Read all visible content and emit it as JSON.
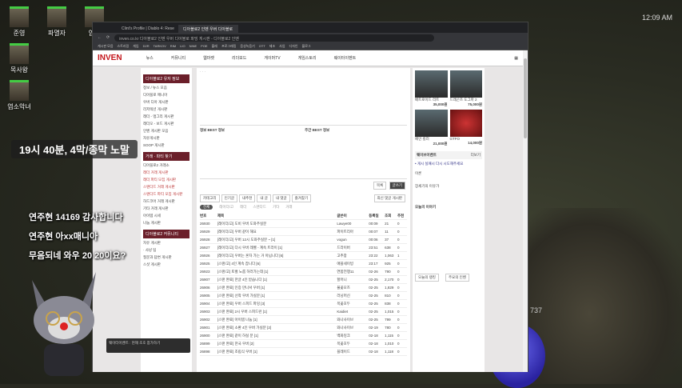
{
  "desktop": {
    "icons": [
      "준영",
      "파멸자",
      "염소",
      "목사왕",
      "염소악녀"
    ]
  },
  "system": {
    "clock": "12:09 AM"
  },
  "game": {
    "value": "737"
  },
  "overlay": {
    "caption": "19시 40분, 4막/종막 노말",
    "chat": [
      "연주현  14169 감사합니다",
      "연주현  아xx매니아",
      "무음되네  와우 20 20이요?"
    ]
  },
  "browser": {
    "tabs": [
      "Clint's Profile | Diablo 4: Rese",
      "디아블로2 인벤 우버 디아블로"
    ],
    "url": "inven.co.kr  디아블로2 인벤 우버 디아블로 파밍 게시판 - 디아블로2 인벤",
    "bookmarks": [
      "게시판 모음",
      "스트리밍",
      "게임",
      "D2R",
      "TARKOV",
      "RIM",
      "LIO",
      "NINE",
      "POE",
      "블레",
      "프로그래밍",
      "음성녹음기",
      "OTT",
      "제조",
      "사업",
      "디자인",
      "블로그"
    ]
  },
  "inven": {
    "logo": "INVEN",
    "nav": [
      "뉴스",
      "커뮤니티",
      "웹마켓",
      "리더보드",
      "게이머TV",
      "게임스토리",
      "웨이터이벤트"
    ],
    "left_nav": {
      "sections": [
        {
          "title": "디아블로2 유저 정보",
          "items": [
            "정보 / 뉴스 모음",
            "디아블로 매니아",
            "우버 디아 게시판",
            "리저렉션 게시판",
            "래더 - 앵그리 게시판",
            "래더오 - 보드 게시판",
            "인벤 게시판 모음",
            "자유게시판",
            "SOOP 게시판"
          ]
        },
        {
          "title": "거래 · 파티 찾기",
          "items": [
            "디아블로2 거래소",
            "래더 거래 게시판",
            "래더 파티 모집 게시판",
            "스탠다드 거래 게시판",
            "스탠다드 파티 모집 게시판",
            "하드코어 거래 게시판",
            "기타 거래 게시판",
            "아이템 시세",
            "나눔 게시판"
          ]
        },
        {
          "title": "디아블로2 커뮤니티",
          "items": [
            "자유 게시판",
            "· 사냥 팁",
            "질문과 답변 게시판",
            "스샷 게시판"
          ]
        }
      ]
    },
    "board": {
      "best_titles": [
        "정보 BEST 정보",
        "주간 BEST 정보"
      ],
      "buttons": [
        "카테고리",
        "인기글",
        "내추천",
        "내 글",
        "내 댓글",
        "즐겨찾기"
      ],
      "sort": "최신 댓글 게시판",
      "filter_tabs": [
        "전체",
        "레이더/고",
        "래더",
        "스탠다드",
        "기타",
        "거래"
      ],
      "headers": [
        "번호",
        "제목",
        "글쓴이",
        "등록일",
        "조회",
        "추천"
      ],
      "action_buttons": [
        "목록",
        "글쓰기"
      ],
      "rows": [
        [
          "26930",
          "[레이더/고] 도비 우버 도와주실분",
          "Lawye00",
          "00:09",
          "21",
          "0"
        ],
        [
          "26929",
          "[레이더/고] 우버 같이 해요",
          "파이트리아",
          "00:07",
          "11",
          "0"
        ],
        [
          "26928",
          "[레이더/고] 우버 12시 도와주실분 ~ [1]",
          "vogun",
          "00:06",
          "37",
          "0"
        ],
        [
          "26927",
          "[레이더/고] 다시 우버 레벨 - 계속 트라이 [1]",
          "드라이버",
          "23:51",
          "638",
          "0"
        ],
        [
          "26926",
          "[레이더/고] 우버는 혼자 가는 거 아닙니다 [6]",
          "고추참",
          "23:22",
          "1,063",
          "1"
        ],
        [
          "26925",
          "[스탠/고] 4인 계속 잡니다 [6]",
          "애플세이빙",
          "23:17",
          "925",
          "0"
        ],
        [
          "26923",
          "[스탠/고] 토벌 노룹 하러가는데 [1]",
          "연합전쟁11",
          "02-26",
          "790",
          "0"
        ],
        [
          "26907",
          "[스탠 완료] 한글 4인 받습니다 [1]",
          "할머니",
          "02-25",
          "2,170",
          "0"
        ],
        [
          "26906",
          "[스탠 완료] 인증 만나서 우버 [1]",
          "불꽃모즈",
          "02-25",
          "1,829",
          "0"
        ],
        [
          "26905",
          "[스탠 완료] 선착 우버 가실분 [1]",
          "러닝머신",
          "02-25",
          "810",
          "0"
        ],
        [
          "26904",
          "[스탠 완료] 우버 스피드 파밍 [3]",
          "목꽃호두",
          "02-25",
          "838",
          "0"
        ],
        [
          "26903",
          "[스탠 완료] 2시 우버 스피드런 [1]",
          "Kaidiet",
          "02-25",
          "1,015",
          "0"
        ],
        [
          "26902",
          "[스탠 완료] 아이템 나눔 [1]",
          "와나사이브",
          "02-25",
          "799",
          "0"
        ],
        [
          "26901",
          "[스탠 완료] 소환 4인 우버 가실분 [2]",
          "와나사이브",
          "02-19",
          "780",
          "0"
        ],
        [
          "26900",
          "[스탠 완료] 같이 하실 분 [1]",
          "백화잉크",
          "02-18",
          "1,115",
          "0"
        ],
        [
          "26899",
          "[스탠 완료] 한국 우버 [2]",
          "목꽃호두",
          "02-18",
          "1,010",
          "0"
        ],
        [
          "26898",
          "[스탠 완료] 조립식 우버 [1]",
          "블레이드",
          "02-18",
          "1,118",
          "0"
        ]
      ]
    },
    "right": {
      "game_prices": [
        "35,000원",
        "75,000원",
        "21,000원",
        "14,000원"
      ],
      "game_names": [
        "배트로이드 리트",
        "드래곤즈 도그마 2",
        "페인 킬러",
        "GTFO"
      ],
      "widget_title": "웨이브이벤트",
      "widget_more": "더보기",
      "widget_text": "• 게시 실패시 다시 시도해주세요",
      "users": [
        "이론",
        "장세기의 이유가"
      ],
      "today_title": "오늘의 이야기",
      "tabs": [
        "오늘의 랭킹",
        "주요의 인벤"
      ]
    },
    "popup": "웨이터이벤트 : 현재 초호 참가하기"
  }
}
